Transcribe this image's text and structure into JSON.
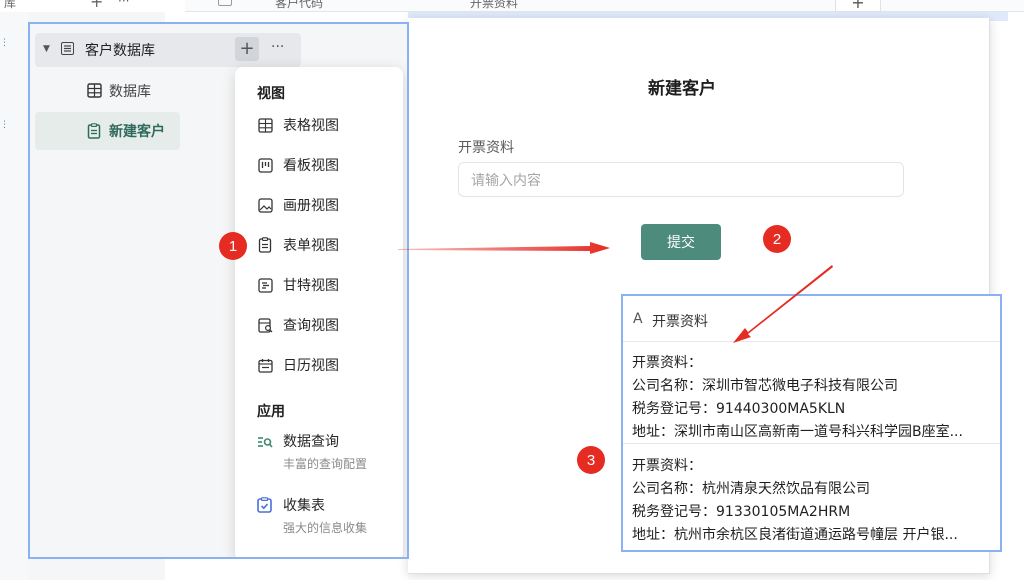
{
  "background": {
    "top_clip_left": "库",
    "top_plus": "+",
    "top_more": "···",
    "col1_clip": "客户代码",
    "col2_clip": "开票资料",
    "top_right_plus": "+"
  },
  "sidebar": {
    "db_name": "客户数据库",
    "add": "+",
    "more": "···",
    "items": [
      {
        "label": "数据库"
      },
      {
        "label": "新建客户"
      }
    ]
  },
  "menu": {
    "section_views": "视图",
    "views": [
      {
        "label": "表格视图",
        "icon": "table-icon"
      },
      {
        "label": "看板视图",
        "icon": "kanban-icon"
      },
      {
        "label": "画册视图",
        "icon": "gallery-icon"
      },
      {
        "label": "表单视图",
        "icon": "form-icon"
      },
      {
        "label": "甘特视图",
        "icon": "gantt-icon"
      },
      {
        "label": "查询视图",
        "icon": "query-icon"
      },
      {
        "label": "日历视图",
        "icon": "calendar-icon"
      }
    ],
    "section_apps": "应用",
    "apps": [
      {
        "label": "数据查询",
        "sub": "丰富的查询配置",
        "icon": "data-query-icon"
      },
      {
        "label": "收集表",
        "sub": "强大的信息收集",
        "icon": "collect-icon"
      }
    ]
  },
  "form": {
    "title": "新建客户",
    "field_label": "开票资料",
    "placeholder": "请输入内容",
    "submit": "提交"
  },
  "badges": [
    "1",
    "2",
    "3"
  ],
  "popup": {
    "header": "开票资料",
    "records": [
      {
        "title": "开票资料：",
        "company": "公司名称：深圳市智芯微电子科技有限公司",
        "tax": "税务登记号：91440300MA5KLN",
        "addr": "地址：深圳市南山区高新南一道号科兴科学园B座室..."
      },
      {
        "title": "开票资料：",
        "company": "公司名称：杭州清泉天然饮品有限公司",
        "tax": "税务登记号：91330105MA2HRM",
        "addr": "地址：杭州市余杭区良渚街道通运路号幢层 开户银..."
      }
    ]
  },
  "colors": {
    "accent": "#4d8c7c",
    "badge": "#e52b22",
    "highlight_border": "#8ab2f2"
  }
}
